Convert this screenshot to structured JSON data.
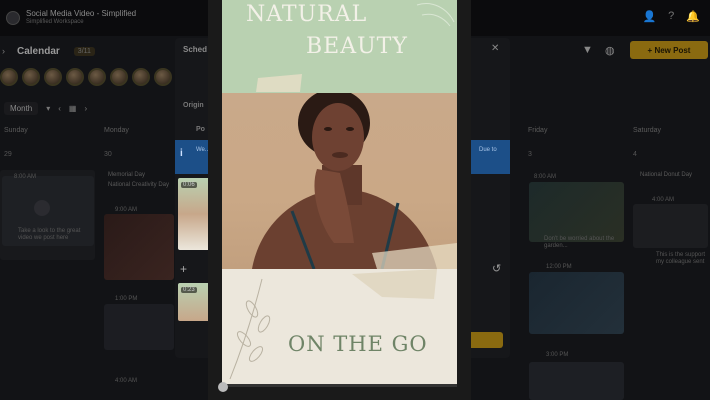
{
  "app": {
    "workspace_name": "Social Media Video - Simplified",
    "workspace_sub": "Simplified Workspace"
  },
  "calendar": {
    "title": "Calendar",
    "badge": "3/11",
    "new_post_label": "+ New Post",
    "view_label": "Month",
    "days": [
      "Sunday",
      "Monday",
      "Friday",
      "Saturday"
    ],
    "dates": [
      "29",
      "30",
      "3",
      "4"
    ],
    "events": {
      "sunday_time": "8:00 AM",
      "sunday_text": "Take a look to the great video we post here",
      "monday_holiday_1": "Memorial Day",
      "monday_holiday_2": "National Creativity Day",
      "monday_time_1": "9:00 AM",
      "monday_time_2": "1:00 PM",
      "monday_time_3": "4:00 AM",
      "friday_time_1": "8:00 AM",
      "friday_text_1": "Don't be worried about the garden...",
      "friday_time_2": "12:00 PM",
      "friday_time_3": "3:00 PM",
      "saturday_holiday": "National Donut Day",
      "saturday_time": "4:00 AM",
      "saturday_text": "This is the support my colleague sent"
    }
  },
  "schedule_dialog": {
    "title": "Sched",
    "original_label": "Origin",
    "tab_label": "Po",
    "info_text": "We... Ins...",
    "info_text_right": "Due to",
    "thumb_time_1": "0:06",
    "thumb_time_2": "0:23"
  },
  "preview": {
    "headline_line1": "NATURAL",
    "headline_line2": "BEAUTY",
    "tagline": "ON THE GO",
    "progress": 0.02
  },
  "colors": {
    "accent": "#8a6a10",
    "info": "#1c4f88",
    "sage": "#b9d1b1",
    "tagline": "#6f8467"
  },
  "icons": {
    "filter": "filter-icon",
    "globe": "globe-icon",
    "close": "close-icon",
    "undo": "undo-icon",
    "plus": "plus-icon"
  }
}
